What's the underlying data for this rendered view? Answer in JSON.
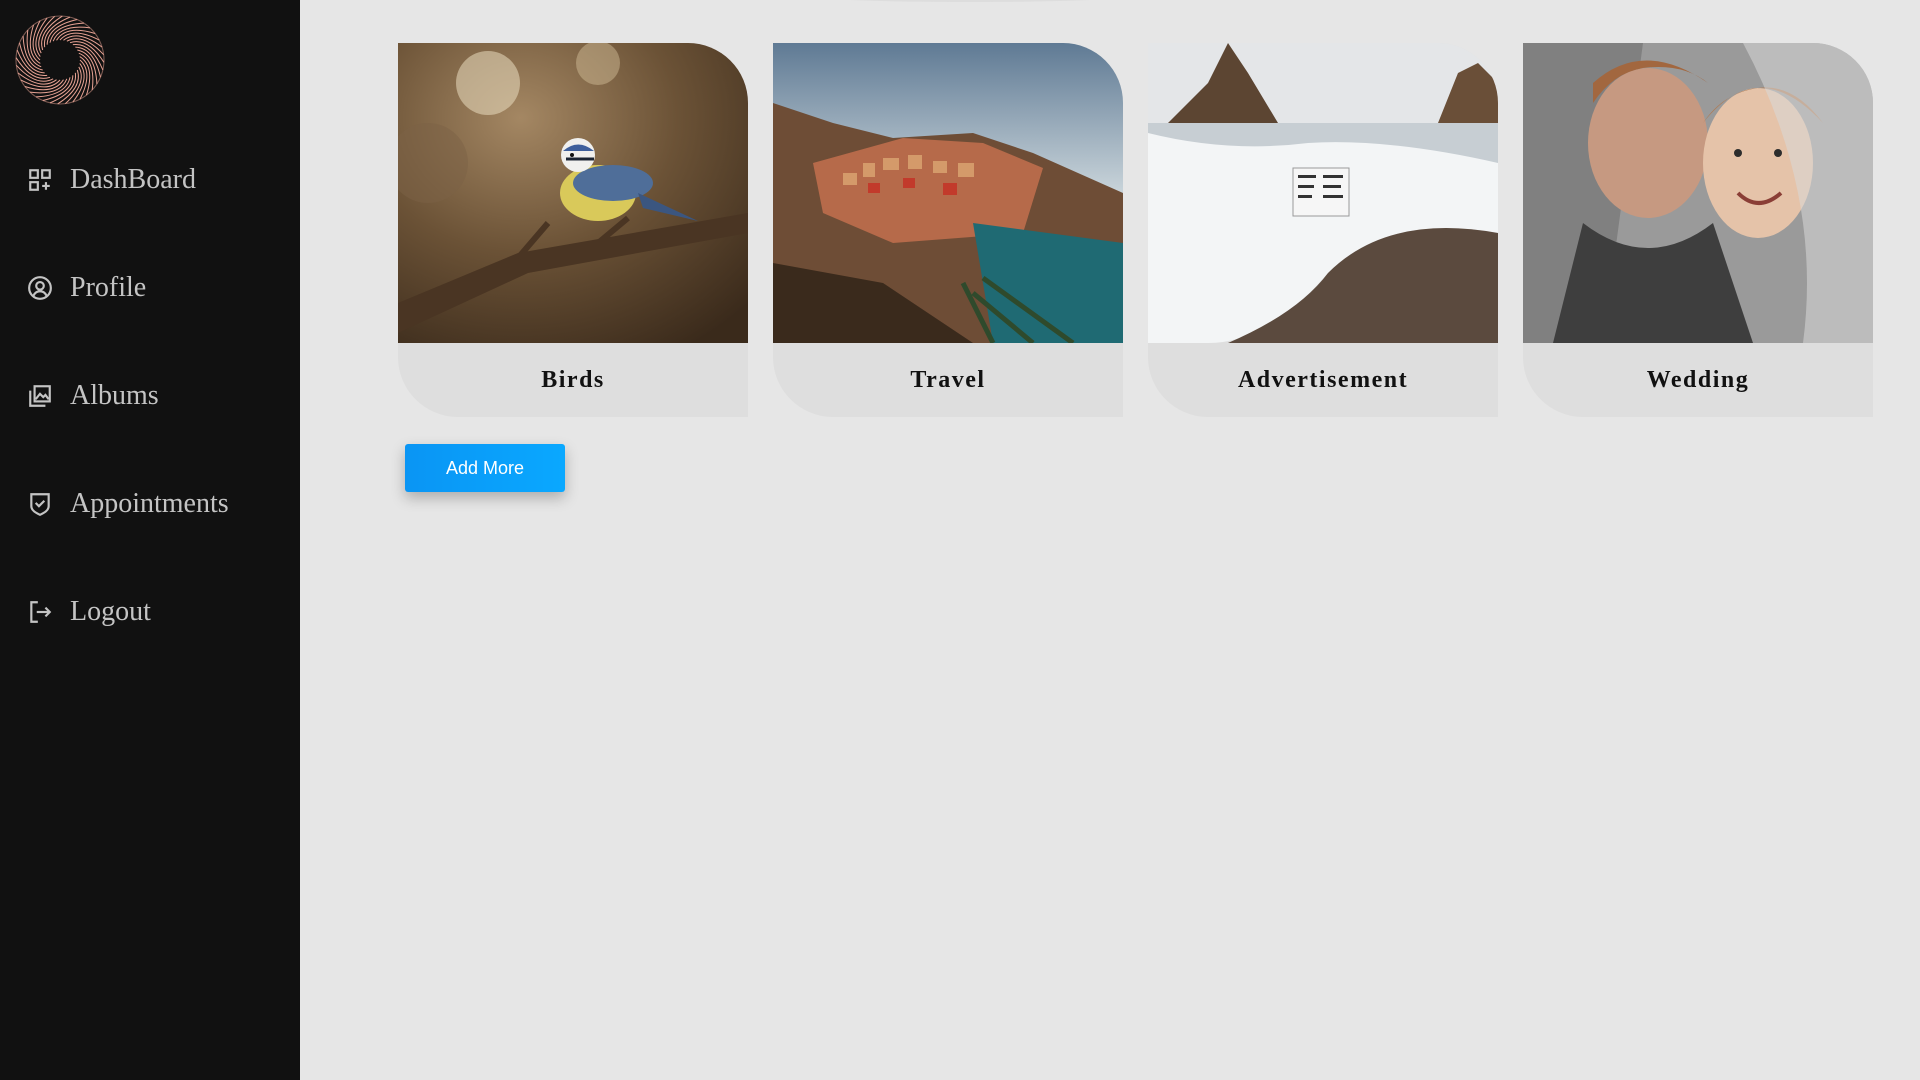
{
  "sidebar": {
    "items": [
      {
        "label": "DashBoard",
        "icon": "dashboard-icon"
      },
      {
        "label": "Profile",
        "icon": "profile-icon"
      },
      {
        "label": "Albums",
        "icon": "albums-icon"
      },
      {
        "label": "Appointments",
        "icon": "appointments-icon"
      },
      {
        "label": "Logout",
        "icon": "logout-icon"
      }
    ]
  },
  "albums": [
    {
      "title": "Birds"
    },
    {
      "title": "Travel"
    },
    {
      "title": "Advertisement"
    },
    {
      "title": "Wedding"
    }
  ],
  "actions": {
    "add_more_label": "Add More"
  },
  "colors": {
    "sidebar_bg": "#111111",
    "main_bg": "#e6e6e6",
    "nav_text": "#c4c4c4",
    "logo_accent": "#e8a394",
    "button_bg": "#0a9cf8"
  }
}
